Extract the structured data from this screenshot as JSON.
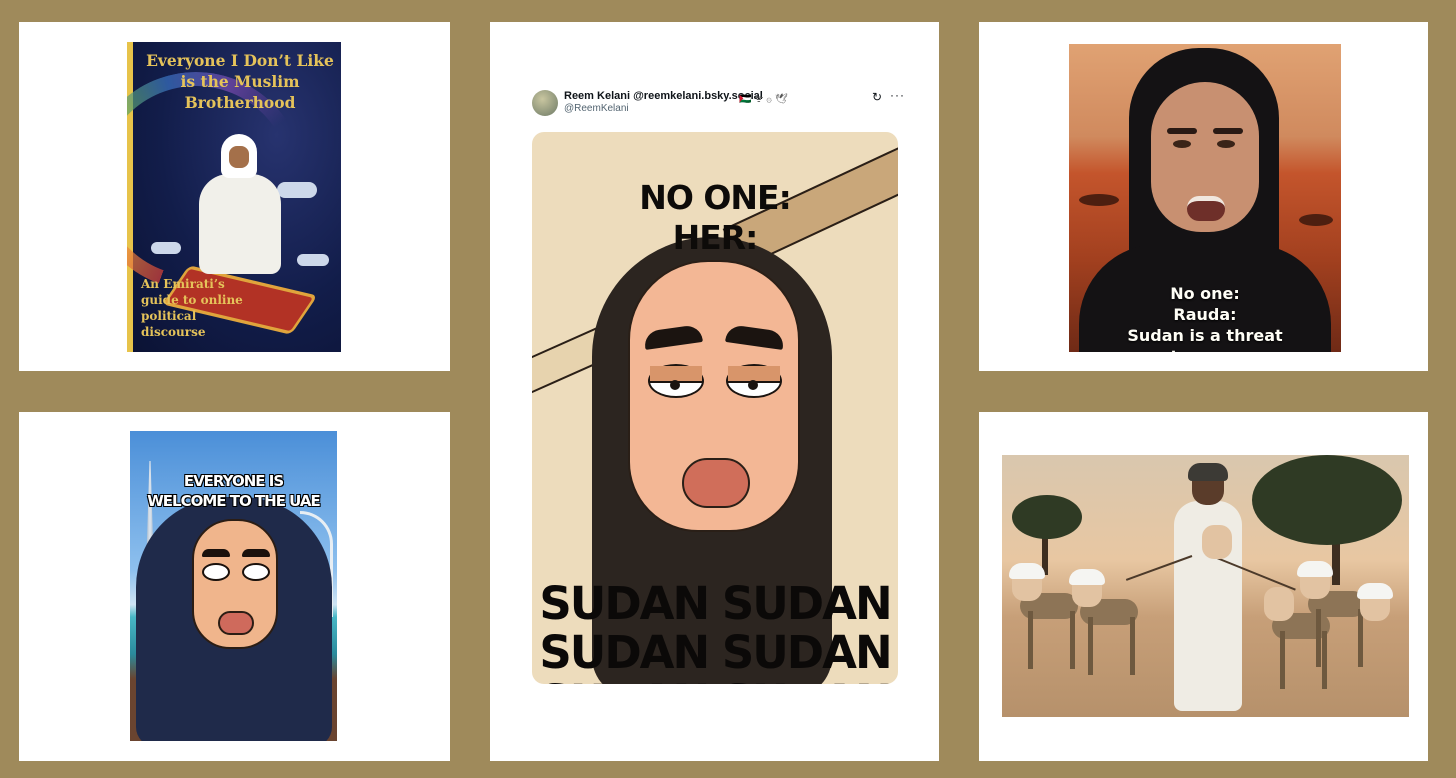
{
  "panels": {
    "book_cover": {
      "title": "Everyone I Don’t Like is the Muslim Brotherhood",
      "subtitle": "An Emirati’s guide to online political discourse"
    },
    "tweet": {
      "author_name": "Reem Kelani @reemkelani.bsky.social",
      "author_flags": "🇵🇸 ᯤ ۞ 🕊",
      "author_handle": "@ReemKelani",
      "refresh_icon": "↻",
      "more_icon": "···",
      "meme_caption": "NO ONE:\nHER:",
      "meme_repeat_text": "SUDAN SUDAN\nSUDAN SUDAN\nSUDAN SUDAN"
    },
    "mars_video": {
      "caption": "No one:\nRauda:\nSudan is a threat\nto mars"
    },
    "uae_cartoon": {
      "caption": "EVERYONE IS\nWELCOME TO THE UAE"
    },
    "dog_walk": {}
  },
  "colors": {
    "background": "#9f8a5b",
    "card": "#ffffff",
    "book_gold": "#e5c35a",
    "book_navy": "#121d4a",
    "meme_beige": "#eddcbc",
    "mars_red": "#c4552c"
  }
}
